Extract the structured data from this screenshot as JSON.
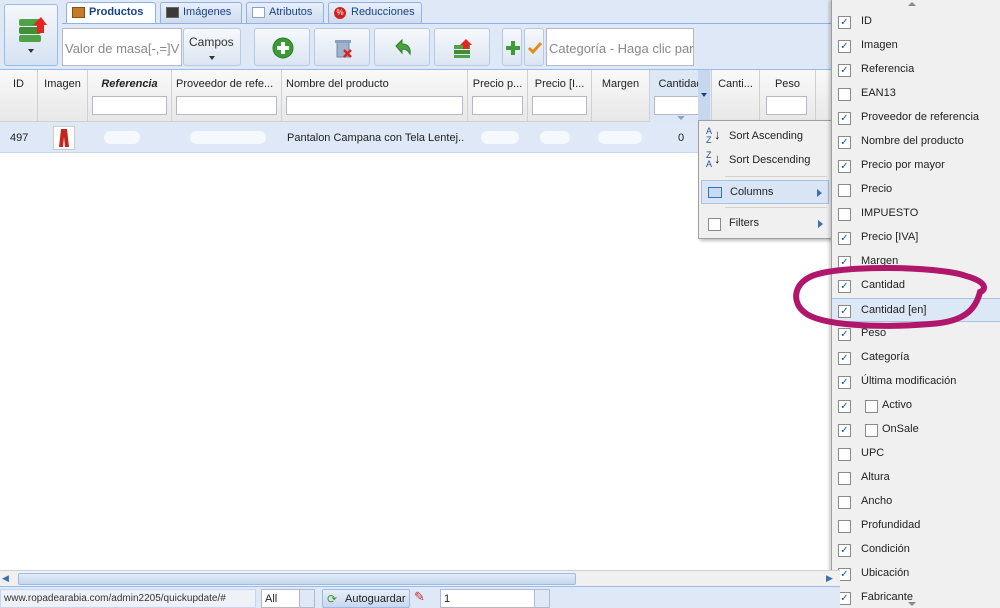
{
  "tabs": [
    {
      "label": "Productos",
      "icon": "box-icon"
    },
    {
      "label": "Imágenes",
      "icon": "image-icon"
    },
    {
      "label": "Atributos",
      "icon": "list-icon"
    },
    {
      "label": "Reducciones",
      "icon": "percent-icon"
    }
  ],
  "toolbar": {
    "mass_value_placeholder": "Valor de masa[-,=]V",
    "fields_label": "Campos",
    "category_placeholder": "Categoría - Haga clic para"
  },
  "grid": {
    "headers": [
      "ID",
      "Imagen",
      "Referencia",
      "Proveedor de refe...",
      "Nombre del producto",
      "Precio p...",
      "Precio [I...",
      "Margen",
      "Cantidad",
      "Canti...",
      "Peso"
    ],
    "row": {
      "id": "497",
      "name": "Pantalon Campana con Tela Lentej...",
      "quantity": "0"
    }
  },
  "context_menu": {
    "items": [
      "Sort Ascending",
      "Sort Descending",
      "Columns",
      "Filters"
    ]
  },
  "columns_menu": {
    "items": [
      {
        "label": "ID",
        "checked": true,
        "indent": false
      },
      {
        "label": "Imagen",
        "checked": true,
        "indent": false
      },
      {
        "label": "Referencia",
        "checked": true,
        "indent": false
      },
      {
        "label": "EAN13",
        "checked": false,
        "indent": false
      },
      {
        "label": "Proveedor de referencia",
        "checked": true,
        "indent": false
      },
      {
        "label": "Nombre del producto",
        "checked": true,
        "indent": false
      },
      {
        "label": "Precio por mayor",
        "checked": true,
        "indent": false
      },
      {
        "label": "Precio",
        "checked": false,
        "indent": false
      },
      {
        "label": "IMPUESTO",
        "checked": false,
        "indent": false
      },
      {
        "label": "Precio [IVA]",
        "checked": true,
        "indent": false
      },
      {
        "label": "Margen",
        "checked": true,
        "indent": false
      },
      {
        "label": "Cantidad",
        "checked": true,
        "indent": false
      },
      {
        "label": "Cantidad [en]",
        "checked": true,
        "indent": false
      },
      {
        "label": "Peso",
        "checked": true,
        "indent": false
      },
      {
        "label": "Categoría",
        "checked": true,
        "indent": false
      },
      {
        "label": "Última modificación",
        "checked": true,
        "indent": false
      },
      {
        "label": "Activo",
        "checked": true,
        "indent": true
      },
      {
        "label": "OnSale",
        "checked": true,
        "indent": true
      },
      {
        "label": "UPC",
        "checked": false,
        "indent": false
      },
      {
        "label": "Altura",
        "checked": false,
        "indent": false
      },
      {
        "label": "Ancho",
        "checked": false,
        "indent": false
      },
      {
        "label": "Profundidad",
        "checked": false,
        "indent": false
      },
      {
        "label": "Condición",
        "checked": true,
        "indent": false
      },
      {
        "label": "Ubicación",
        "checked": true,
        "indent": false
      },
      {
        "label": "Fabricante",
        "checked": true,
        "indent": false
      }
    ]
  },
  "statusbar": {
    "url": "www.ropadearabia.com/admin2205/quickupdate/#",
    "filter_value": "All",
    "autosave_label": "Autoguardar",
    "page_value": "1"
  },
  "colors": {
    "accent": "#15428b",
    "highlight_circle": "#b0176b",
    "selected_row": "#dfe8f6"
  }
}
